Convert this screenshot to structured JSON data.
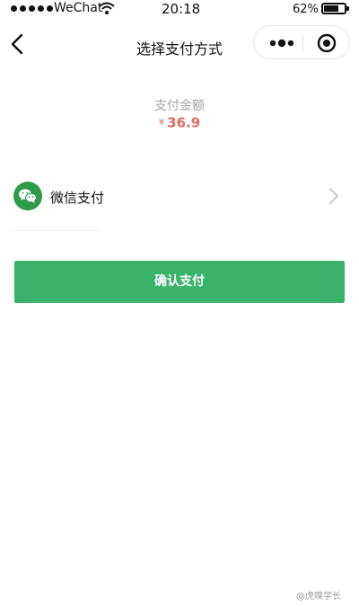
{
  "status_bar": {
    "carrier": "WeChat",
    "time": "20:18",
    "battery_percent": "62%",
    "battery_level": 0.62
  },
  "nav": {
    "title": "选择支付方式",
    "back_icon": "chevron-left-icon",
    "more_icon": "more-dots-icon",
    "close_icon": "target-circle-icon"
  },
  "payment": {
    "amount_label": "支付金额",
    "currency_symbol": "¥",
    "amount": "36.9",
    "amount_color": "#e06a5f"
  },
  "methods": [
    {
      "label": "微信支付",
      "icon": "wechat-icon",
      "icon_color": "#2f9b48"
    }
  ],
  "confirm_button": {
    "label": "确认支付",
    "color": "#3ab26a"
  },
  "watermark": "@虎嗅学长"
}
